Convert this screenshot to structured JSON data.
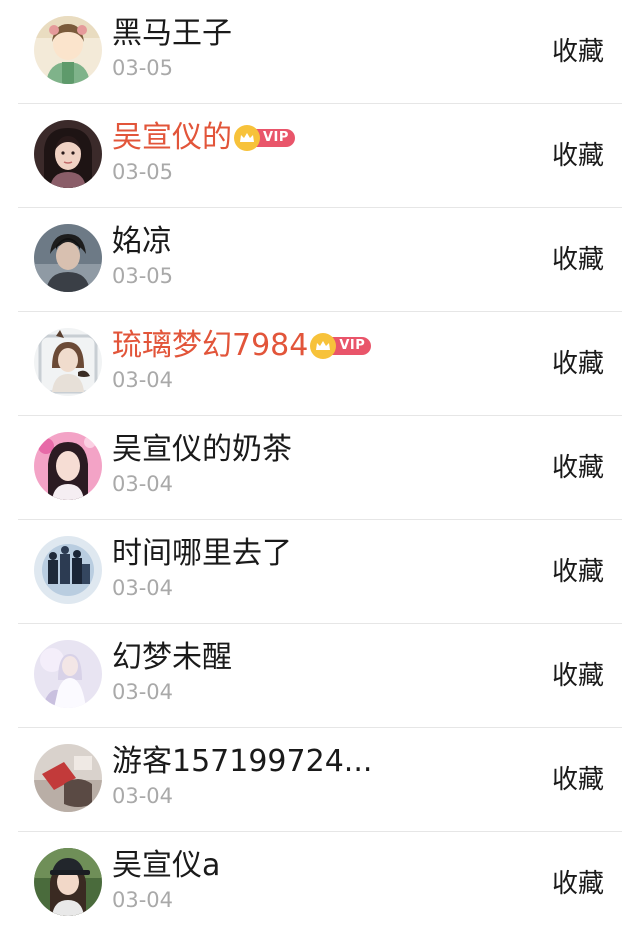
{
  "action_label": "收藏",
  "vip_label": "VIP",
  "colors": {
    "vip_name": "#e2553a",
    "vip_tag": "#e9556a",
    "crown": "#f7c23a",
    "date": "#a9a9a9"
  },
  "items": [
    {
      "name": "黑马王子",
      "date": "03-05",
      "vip": false,
      "avatar": "cartoon-girl-avatar"
    },
    {
      "name": "吴宣仪的",
      "date": "03-05",
      "vip": true,
      "avatar": "girl-portrait-avatar"
    },
    {
      "name": "姳凉",
      "date": "03-05",
      "vip": false,
      "avatar": "boy-portrait-avatar"
    },
    {
      "name": "琉璃梦幻7984",
      "date": "03-04",
      "vip": true,
      "avatar": "girl-with-bird-avatar"
    },
    {
      "name": "吴宣仪的奶茶",
      "date": "03-04",
      "vip": false,
      "avatar": "pink-girl-avatar"
    },
    {
      "name": "时间哪里去了",
      "date": "03-04",
      "vip": false,
      "avatar": "dark-figures-avatar"
    },
    {
      "name": "幻梦未醒",
      "date": "03-04",
      "vip": false,
      "avatar": "white-dress-girl-avatar"
    },
    {
      "name": "游客157199724...",
      "date": "03-04",
      "vip": false,
      "avatar": "photo-avatar"
    },
    {
      "name": "吴宣仪a",
      "date": "03-04",
      "vip": false,
      "avatar": "cap-girl-avatar"
    }
  ]
}
